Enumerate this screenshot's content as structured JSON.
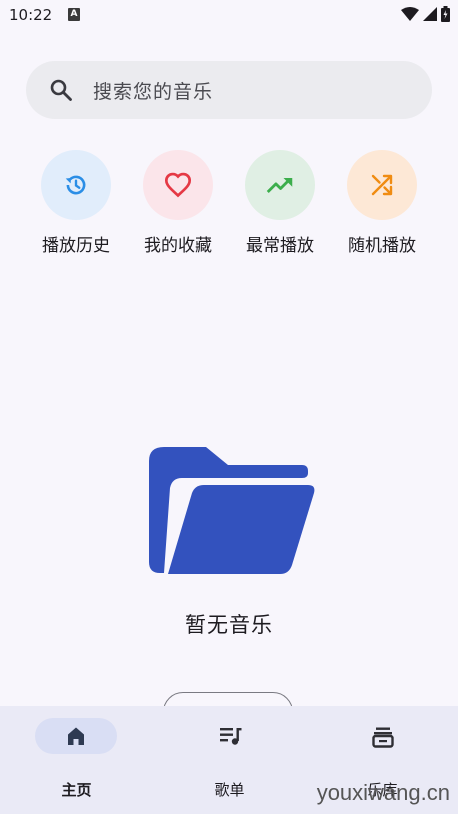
{
  "status_bar": {
    "time": "10:22",
    "notification_letter": "A"
  },
  "search": {
    "placeholder": "搜索您的音乐",
    "icon": "search-icon"
  },
  "quick_actions": [
    {
      "label": "播放历史",
      "icon": "history-icon",
      "bg": "#e1edfb",
      "color": "#2b8ee6"
    },
    {
      "label": "我的收藏",
      "icon": "heart-icon",
      "bg": "#fbe5ea",
      "color": "#e53945"
    },
    {
      "label": "最常播放",
      "icon": "trending-up-icon",
      "bg": "#e0efe4",
      "color": "#3cae4c"
    },
    {
      "label": "随机播放",
      "icon": "shuffle-icon",
      "bg": "#fde8d6",
      "color": "#f08c12"
    }
  ],
  "empty_state": {
    "icon": "folder-open-icon",
    "color": "#3352be",
    "text": "暂无音乐"
  },
  "bottom_nav": [
    {
      "label": "主页",
      "icon": "home-icon",
      "active": true
    },
    {
      "label": "歌单",
      "icon": "playlist-icon",
      "active": false
    },
    {
      "label": "乐库",
      "icon": "library-icon",
      "active": false
    }
  ],
  "watermark": "youxiwang.cn"
}
